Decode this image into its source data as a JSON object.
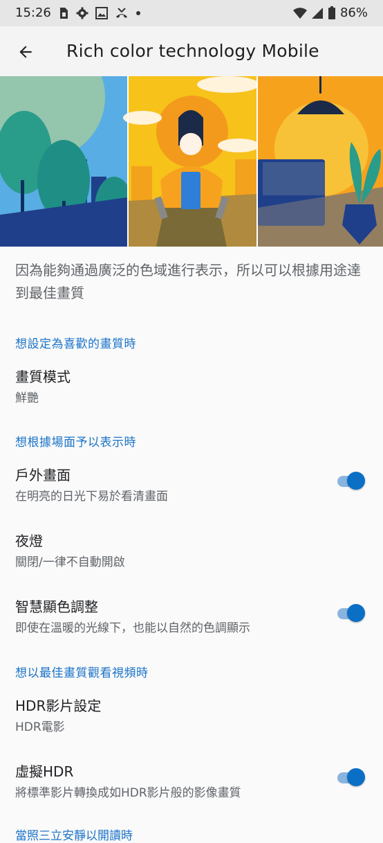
{
  "status": {
    "time": "15:26",
    "battery": "86%",
    "icons_left": [
      "sim-icon",
      "gear-icon",
      "image-icon",
      "missed-call-icon",
      "dot-icon"
    ],
    "icons_right": [
      "wifi-icon",
      "signal-icon",
      "battery-icon"
    ]
  },
  "appbar": {
    "title": "Rich color technology Mobile"
  },
  "description": "因為能夠通過廣泛的色域進行表示，所以可以根據用途達到最佳畫質",
  "sections": [
    {
      "title": "想設定為喜歡的畫質時",
      "items": [
        {
          "title": "畫質模式",
          "subtitle": "鮮艷"
        }
      ]
    },
    {
      "title": "想根據場面予以表示時",
      "items": [
        {
          "title": "戶外畫面",
          "subtitle": "在明亮的日光下易於看清畫面",
          "toggle": true
        },
        {
          "title": "夜燈",
          "subtitle": "關閉/一律不自動開啟"
        },
        {
          "title": "智慧顯色調整",
          "subtitle": "即使在溫暖的光線下，也能以自然的色調顯示",
          "toggle": true
        }
      ]
    },
    {
      "title": "想以最佳畫質觀看視頻時",
      "items": [
        {
          "title": "HDR影片設定",
          "subtitle": "HDR電影"
        },
        {
          "title": "虛擬HDR",
          "subtitle": "將標準影片轉換成如HDR影片般的影像畫質",
          "toggle": true
        }
      ]
    }
  ],
  "partial_section_title": "當照三立安靜以開讀時",
  "colors": {
    "accent": "#1a73c8",
    "toggle_thumb": "#0b6fc6",
    "toggle_track": "#8ab4e0"
  }
}
